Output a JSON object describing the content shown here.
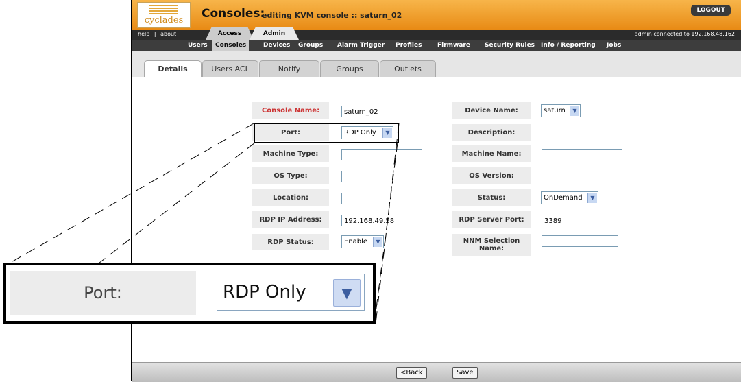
{
  "header": {
    "logo_text": "cyclades",
    "title": "Consoles:",
    "subtitle": "editing KVM console :: saturn_02",
    "logout_label": "LOGOUT"
  },
  "subbar": {
    "help": "help",
    "separator": "|",
    "about": "about",
    "access_tab": "Access",
    "admin_tab": "Admin",
    "connection_info": "admin connected to 192.168.48.162"
  },
  "nav": {
    "items": [
      "Users",
      "Consoles",
      "Devices",
      "Groups",
      "Alarm Trigger",
      "Profiles",
      "Firmware",
      "Security Rules",
      "Info / Reporting",
      "Jobs"
    ],
    "active": "Consoles"
  },
  "tabs": [
    "Details",
    "Users ACL",
    "Notify",
    "Groups",
    "Outlets"
  ],
  "form": {
    "console_name": {
      "label": "Console Name:",
      "value": "saturn_02"
    },
    "port": {
      "label": "Port:",
      "value": "RDP Only"
    },
    "machine_type": {
      "label": "Machine Type:",
      "value": ""
    },
    "os_type": {
      "label": "OS Type:",
      "value": ""
    },
    "location": {
      "label": "Location:",
      "value": ""
    },
    "rdp_ip": {
      "label": "RDP IP Address:",
      "value": "192.168.49.58"
    },
    "rdp_status": {
      "label": "RDP Status:",
      "value": "Enable"
    },
    "device_name": {
      "label": "Device Name:",
      "value": "saturn"
    },
    "description": {
      "label": "Description:",
      "value": ""
    },
    "machine_name": {
      "label": "Machine Name:",
      "value": ""
    },
    "os_version": {
      "label": "OS Version:",
      "value": ""
    },
    "status": {
      "label": "Status:",
      "value": "OnDemand"
    },
    "rdp_server_port": {
      "label": "RDP Server Port:",
      "value": "3389"
    },
    "nnm_selection": {
      "label": "NNM Selection Name:",
      "value": ""
    }
  },
  "footer": {
    "back_label": "<Back",
    "save_label": "Save"
  },
  "zoom": {
    "label": "Port:",
    "value": "RDP Only"
  },
  "icons": {
    "dropdown": "chevron-down-icon",
    "logo": "cyclades-logo"
  },
  "colors": {
    "header": "#e88a14",
    "required_label": "#cc3333",
    "nav": "#3d3d3d"
  }
}
